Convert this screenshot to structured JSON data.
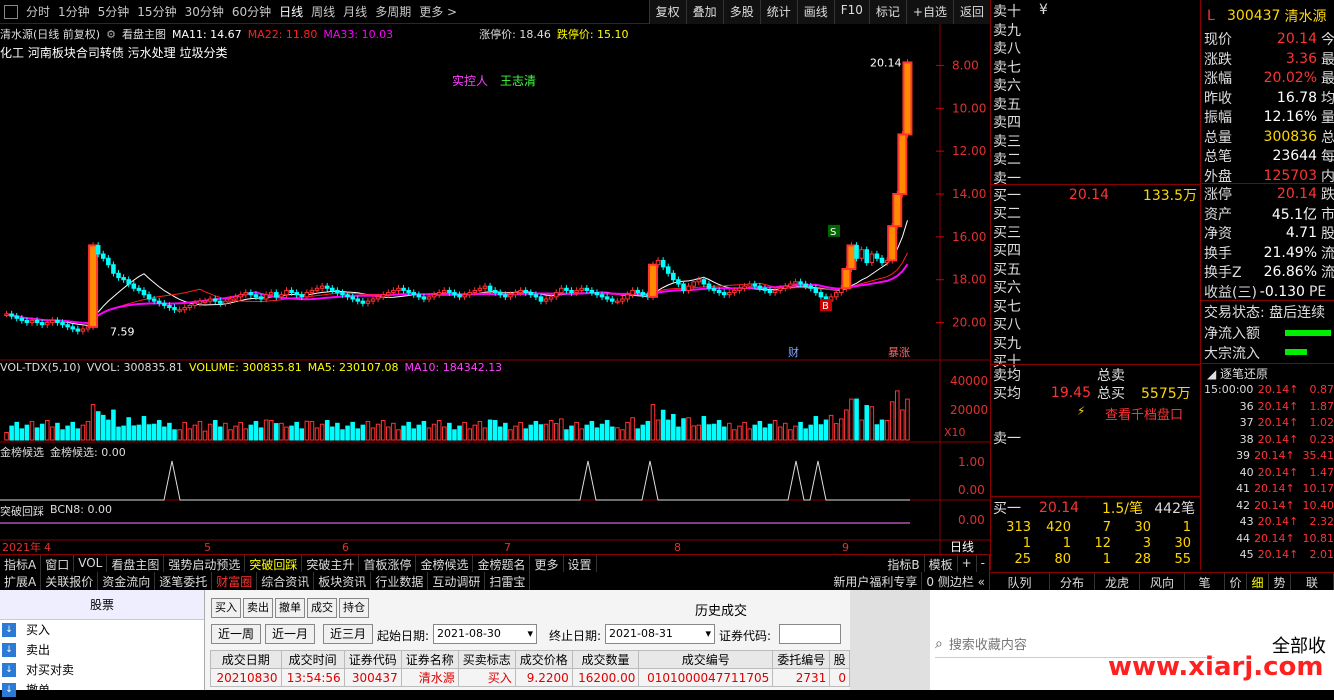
{
  "topbar": {
    "periods": [
      "分时",
      "1分钟",
      "5分钟",
      "15分钟",
      "30分钟",
      "60分钟",
      "日线",
      "周线",
      "月线",
      "多周期",
      "更多 >"
    ],
    "active_period": "日线",
    "right_buttons": [
      "复权",
      "叠加",
      "多股",
      "统计",
      "画线",
      "F10",
      "标记",
      "+自选",
      "返回"
    ]
  },
  "main": {
    "stock_label": "清水源(日线 前复权)",
    "chart_mode": "看盘主图",
    "ma11": "MA11: 14.67",
    "ma22": "MA22: 11.80",
    "ma33": "MA33: 10.03",
    "limit_up": "涨停价: 18.46",
    "limit_down": "跌停价: 15.10",
    "concepts": "化工    河南板块合司转债 污水处理 垃圾分类",
    "controller_label": "实控人",
    "controller_name": "王志清",
    "high_label": "20.14",
    "low_label": "7.59",
    "marker_s": "S",
    "marker_b": "B",
    "marker_cai": "财",
    "marker_juzhang": "暴涨",
    "price_ticks": [
      "20.00",
      "18.00",
      "16.00",
      "14.00",
      "12.00",
      "10.00",
      "8.00"
    ]
  },
  "vol_panel": {
    "title": "VOL-TDX(5,10)",
    "vvol": "VVOL: 300835.81",
    "volume": "VOLUME: 300835.81",
    "ma5": "MA5: 230107.08",
    "ma10": "MA10: 184342.13",
    "ticks": [
      "40000",
      "20000",
      "X10"
    ]
  },
  "jb_panel": {
    "title": "金榜候选",
    "value": "金榜候选: 0.00",
    "ticks": [
      "1.00",
      "0.00"
    ]
  },
  "tp_panel": {
    "title": "突破回踩",
    "value": "BCN8: 0.00",
    "ticks": [
      "0.00"
    ]
  },
  "xaxis": {
    "labels": [
      "2021年",
      "4",
      "5",
      "6",
      "7",
      "8",
      "9"
    ],
    "period": "日线"
  },
  "bottom_tabs": [
    "指标A",
    "窗口",
    "VOL",
    "看盘主图",
    "强势启动预选",
    "突破回踩",
    "突破主升",
    "首板涨停",
    "金榜候选",
    "金榜题名",
    "更多",
    "设置"
  ],
  "bottom_tabs_right": [
    "指标B",
    "模板",
    "+",
    "-"
  ],
  "tabs2": [
    "扩展A",
    "关联报价",
    "资金流向",
    "逐笔委托",
    "财富圈",
    "综合资讯",
    "板块资讯",
    "行业数据",
    "互动调研",
    "扫雷宝"
  ],
  "tabs2_right": "新用户福利专享",
  "tabs2_side": "0 侧边栏 «",
  "tabs3": [
    "队列",
    "分布",
    "龙虎",
    "风向",
    "笔",
    "价",
    "细",
    "势",
    "联"
  ],
  "orderbook": {
    "sells": [
      "卖十",
      "卖九",
      "卖八",
      "卖七",
      "卖六",
      "卖五",
      "卖四",
      "卖三",
      "卖二",
      "卖一"
    ],
    "sell_top_extra": "¥",
    "buy1": {
      "label": "买一",
      "price": "20.14",
      "vol": "133.5万"
    },
    "buys": [
      "买二",
      "买三",
      "买四",
      "买五",
      "买六",
      "买七",
      "买八",
      "买九",
      "买十"
    ],
    "avg_sell": "卖均",
    "total_sell": "总卖",
    "avg_buy": "买均",
    "avg_buy_price": "19.45",
    "total_buy": "总买",
    "total_buy_vol": "5575万",
    "thousand_link": "查看千档盘口",
    "sell1_label": "卖一",
    "queue_label": "买一",
    "queue_price": "20.14",
    "queue_per": "1.5/笔",
    "queue_count": "442笔",
    "queue_rows": [
      [
        "313",
        "420",
        "7",
        "30",
        "1"
      ],
      [
        "1",
        "1",
        "12",
        "3",
        "30"
      ],
      [
        "25",
        "80",
        "1",
        "28",
        "55"
      ]
    ]
  },
  "quote": {
    "code": "300437",
    "name": "清水源",
    "flag": "L",
    "rows": [
      {
        "k": "现价",
        "v": "20.14",
        "k2": "今",
        "c": "#ff3333"
      },
      {
        "k": "涨跌",
        "v": "3.36",
        "k2": "最",
        "c": "#ff3333"
      },
      {
        "k": "涨幅",
        "v": "20.02%",
        "k2": "最",
        "c": "#ff3333"
      },
      {
        "k": "昨收",
        "v": "16.78",
        "k2": "均",
        "c": "#ffffff"
      },
      {
        "k": "振幅",
        "v": "12.16%",
        "k2": "量",
        "c": "#ffffff"
      },
      {
        "k": "总量",
        "v": "300836",
        "k2": "总",
        "c": "#ffd700"
      },
      {
        "k": "总笔",
        "v": "23644",
        "k2": "每",
        "c": "#ffffff"
      },
      {
        "k": "外盘",
        "v": "125703",
        "k2": "内",
        "c": "#ff3333"
      }
    ],
    "rows2": [
      {
        "k": "涨停",
        "v": "20.14",
        "k2": "跌",
        "c": "#ff3333"
      },
      {
        "k": "资产",
        "v": "45.1亿",
        "k2": "市",
        "c": "#ffffff"
      },
      {
        "k": "净资",
        "v": "4.71",
        "k2": "股",
        "c": "#ffffff"
      },
      {
        "k": "换手",
        "v": "21.49%",
        "k2": "流",
        "c": "#ffffff"
      },
      {
        "k": "换手Z",
        "v": "26.86%",
        "k2": "流",
        "c": "#ffffff"
      },
      {
        "k": "收益(三)",
        "v": "-0.130",
        "k2": "PE",
        "c": "#ffffff"
      }
    ],
    "trade_status": "交易状态: 盘后连续",
    "net_inflow": "净流入额",
    "block_inflow": "大宗流入"
  },
  "ticks": {
    "title": "逐笔还原",
    "rows": [
      {
        "t": "15:00:00",
        "p": "20.14",
        "v": "0.87"
      },
      {
        "t": "36",
        "p": "20.14",
        "v": "1.87"
      },
      {
        "t": "37",
        "p": "20.14",
        "v": "1.02"
      },
      {
        "t": "38",
        "p": "20.14",
        "v": "0.23"
      },
      {
        "t": "39",
        "p": "20.14",
        "v": "35.41"
      },
      {
        "t": "40",
        "p": "20.14",
        "v": "1.47"
      },
      {
        "t": "41",
        "p": "20.14",
        "v": "10.17"
      },
      {
        "t": "42",
        "p": "20.14",
        "v": "10.40"
      },
      {
        "t": "43",
        "p": "20.14",
        "v": "2.32"
      },
      {
        "t": "44",
        "p": "20.14",
        "v": "10.81"
      },
      {
        "t": "45",
        "p": "20.14",
        "v": "2.01"
      }
    ]
  },
  "trade": {
    "nav_header": "股票",
    "nav_items": [
      {
        "label": "买入",
        "icon": "buy-icon"
      },
      {
        "label": "卖出",
        "icon": "sell-icon"
      },
      {
        "label": "对买对卖",
        "icon": "swap-icon"
      },
      {
        "label": "撤单",
        "icon": "cancel-icon"
      }
    ],
    "buttons": [
      "买入",
      "卖出",
      "撤单",
      "成交",
      "持仓"
    ],
    "title": "历史成交",
    "range_buttons": [
      "近一周",
      "近一月",
      "近三月"
    ],
    "start_label": "起始日期:",
    "start_date": "2021-08-30",
    "end_label": "终止日期:",
    "end_date": "2021-08-31",
    "code_label": "证券代码:",
    "columns": [
      "成交日期",
      "成交时间",
      "证券代码",
      "证券名称",
      "买卖标志",
      "成交价格",
      "成交数量",
      "成交编号",
      "委托编号",
      "股"
    ],
    "rows": [
      [
        "20210830",
        "13:54:56",
        "300437",
        "清水源",
        "买入",
        "9.2200",
        "16200.00",
        "0101000047711705",
        "2731",
        "0"
      ]
    ],
    "search_placeholder": "搜索收藏内容",
    "all_fav": "全部收",
    "watermark": "www.xiarj.com"
  },
  "chart_data": {
    "type": "candlestick",
    "title": "清水源(日线 前复权)",
    "ylim": [
      7,
      21
    ],
    "yticks": [
      8,
      10,
      12,
      14,
      16,
      18,
      20
    ],
    "close": [
      8.4,
      8.3,
      8.2,
      8.1,
      8.0,
      8.1,
      8.0,
      7.9,
      8.0,
      8.1,
      8.0,
      7.9,
      7.8,
      7.7,
      7.6,
      7.7,
      7.8,
      11.6,
      11.2,
      11.0,
      10.7,
      10.3,
      10.1,
      10.0,
      9.8,
      9.6,
      9.5,
      9.3,
      9.1,
      9.0,
      8.9,
      8.8,
      8.7,
      8.6,
      8.6,
      8.7,
      8.8,
      8.9,
      9.0,
      9.0,
      9.1,
      9.0,
      8.9,
      9.0,
      9.1,
      9.2,
      9.3,
      9.4,
      9.3,
      9.2,
      9.1,
      9.3,
      9.4,
      9.2,
      9.3,
      9.5,
      9.4,
      9.3,
      9.2,
      9.4,
      9.5,
      9.6,
      9.7,
      9.6,
      9.5,
      9.4,
      9.3,
      9.2,
      9.1,
      9.0,
      8.9,
      9.0,
      9.1,
      9.2,
      9.3,
      9.4,
      9.5,
      9.6,
      9.5,
      9.4,
      9.3,
      9.2,
      9.1,
      9.2,
      9.3,
      9.4,
      9.5,
      9.4,
      9.3,
      9.2,
      9.3,
      9.4,
      9.5,
      9.6,
      9.7,
      9.5,
      9.4,
      9.3,
      9.2,
      9.3,
      9.4,
      9.5,
      9.4,
      9.3,
      9.2,
      9.0,
      9.1,
      9.2,
      9.4,
      9.6,
      9.5,
      9.4,
      9.5,
      9.6,
      9.5,
      9.4,
      9.3,
      9.2,
      9.1,
      9.0,
      9.0,
      9.1,
      9.3,
      9.5,
      9.4,
      9.3,
      9.2,
      10.7,
      10.9,
      10.6,
      10.3,
      10.0,
      9.8,
      9.5,
      9.7,
      9.9,
      10.0,
      9.8,
      9.6,
      9.5,
      9.4,
      9.3,
      9.4,
      9.5,
      9.6,
      9.7,
      9.8,
      9.7,
      9.6,
      9.5,
      9.4,
      9.5,
      9.6,
      9.7,
      9.8,
      9.9,
      9.8,
      9.7,
      9.6,
      9.4,
      9.2,
      9.0,
      9.2,
      9.4,
      9.6,
      10.5,
      11.6,
      11.0,
      11.4,
      10.8,
      11.2,
      11.0,
      10.8,
      10.9,
      12.5,
      14.0,
      16.78,
      20.14
    ]
  }
}
